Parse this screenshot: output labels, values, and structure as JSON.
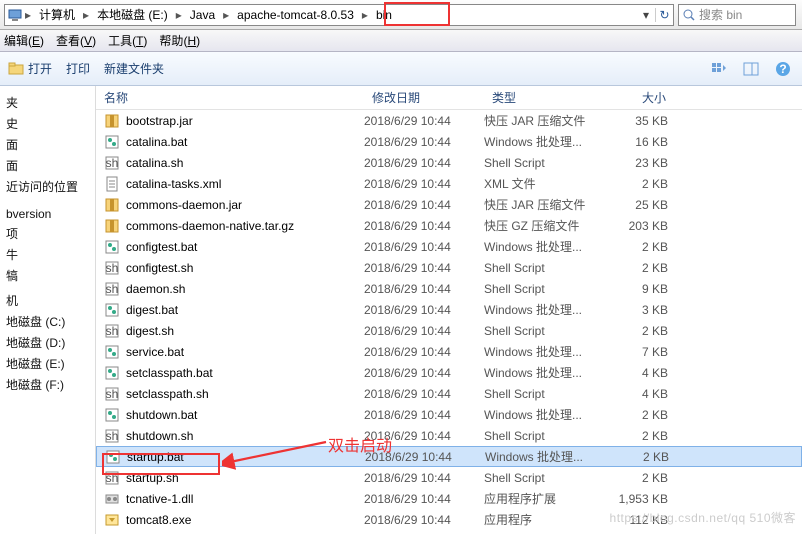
{
  "breadcrumb": [
    "计算机",
    "本地磁盘 (E:)",
    "Java",
    "apache-tomcat-8.0.53",
    "bin"
  ],
  "search_placeholder": "搜索 bin",
  "menus": [
    {
      "label": "编辑",
      "key": "E"
    },
    {
      "label": "查看",
      "key": "V"
    },
    {
      "label": "工具",
      "key": "T"
    },
    {
      "label": "帮助",
      "key": "H"
    }
  ],
  "toolbar": {
    "open": "打开",
    "print": "打印",
    "newfolder": "新建文件夹"
  },
  "sidebar": [
    "夹",
    "史",
    "面",
    "面",
    "近访问的位置",
    "",
    "",
    "bversion",
    "项",
    "牛",
    "犒",
    "",
    "机",
    "地磁盘 (C:)",
    "地磁盘 (D:)",
    "地磁盘 (E:)",
    "地磁盘 (F:)"
  ],
  "columns": {
    "name": "名称",
    "date": "修改日期",
    "type": "类型",
    "size": "大小"
  },
  "rows": [
    {
      "icon": "jar",
      "name": "bootstrap.jar",
      "date": "2018/6/29 10:44",
      "type": "快压 JAR 压缩文件",
      "size": "35 KB"
    },
    {
      "icon": "bat",
      "name": "catalina.bat",
      "date": "2018/6/29 10:44",
      "type": "Windows 批处理...",
      "size": "16 KB"
    },
    {
      "icon": "sh",
      "name": "catalina.sh",
      "date": "2018/6/29 10:44",
      "type": "Shell Script",
      "size": "23 KB"
    },
    {
      "icon": "xml",
      "name": "catalina-tasks.xml",
      "date": "2018/6/29 10:44",
      "type": "XML 文件",
      "size": "2 KB"
    },
    {
      "icon": "jar",
      "name": "commons-daemon.jar",
      "date": "2018/6/29 10:44",
      "type": "快压 JAR 压缩文件",
      "size": "25 KB"
    },
    {
      "icon": "gz",
      "name": "commons-daemon-native.tar.gz",
      "date": "2018/6/29 10:44",
      "type": "快压 GZ 压缩文件",
      "size": "203 KB"
    },
    {
      "icon": "bat",
      "name": "configtest.bat",
      "date": "2018/6/29 10:44",
      "type": "Windows 批处理...",
      "size": "2 KB"
    },
    {
      "icon": "sh",
      "name": "configtest.sh",
      "date": "2018/6/29 10:44",
      "type": "Shell Script",
      "size": "2 KB"
    },
    {
      "icon": "sh",
      "name": "daemon.sh",
      "date": "2018/6/29 10:44",
      "type": "Shell Script",
      "size": "9 KB"
    },
    {
      "icon": "bat",
      "name": "digest.bat",
      "date": "2018/6/29 10:44",
      "type": "Windows 批处理...",
      "size": "3 KB"
    },
    {
      "icon": "sh",
      "name": "digest.sh",
      "date": "2018/6/29 10:44",
      "type": "Shell Script",
      "size": "2 KB"
    },
    {
      "icon": "bat",
      "name": "service.bat",
      "date": "2018/6/29 10:44",
      "type": "Windows 批处理...",
      "size": "7 KB"
    },
    {
      "icon": "bat",
      "name": "setclasspath.bat",
      "date": "2018/6/29 10:44",
      "type": "Windows 批处理...",
      "size": "4 KB"
    },
    {
      "icon": "sh",
      "name": "setclasspath.sh",
      "date": "2018/6/29 10:44",
      "type": "Shell Script",
      "size": "4 KB"
    },
    {
      "icon": "bat",
      "name": "shutdown.bat",
      "date": "2018/6/29 10:44",
      "type": "Windows 批处理...",
      "size": "2 KB"
    },
    {
      "icon": "sh",
      "name": "shutdown.sh",
      "date": "2018/6/29 10:44",
      "type": "Shell Script",
      "size": "2 KB"
    },
    {
      "icon": "bat",
      "name": "startup.bat",
      "date": "2018/6/29 10:44",
      "type": "Windows 批处理...",
      "size": "2 KB",
      "selected": true
    },
    {
      "icon": "sh",
      "name": "startup.sh",
      "date": "2018/6/29 10:44",
      "type": "Shell Script",
      "size": "2 KB"
    },
    {
      "icon": "dll",
      "name": "tcnative-1.dll",
      "date": "2018/6/29 10:44",
      "type": "应用程序扩展",
      "size": "1,953 KB"
    },
    {
      "icon": "exe",
      "name": "tomcat8.exe",
      "date": "2018/6/29 10:44",
      "type": "应用程序",
      "size": "112 KB"
    }
  ],
  "annotation": "双击启动",
  "watermark": "https://blog.csdn.net/qq 510微客"
}
